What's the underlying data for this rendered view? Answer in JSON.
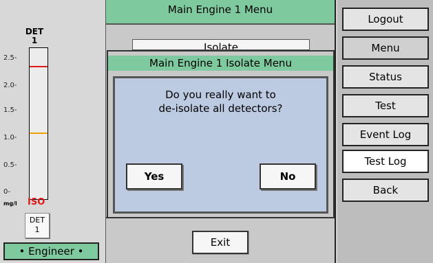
{
  "left": {
    "det_title": "DET",
    "det_number": "1",
    "ticks": [
      "2.5-",
      "2.0-",
      "1.5-",
      "1.0-",
      "0.5-",
      "0-"
    ],
    "unit": "mg/l",
    "iso_status": "ISO",
    "det_button_label": "DET",
    "det_button_number": "1",
    "user_role": "• Engineer •",
    "high_alarm_level": 2.2,
    "low_alarm_level": 1.1,
    "scale_max": 2.5,
    "colors": {
      "high": "#e01818",
      "low": "#f0a000",
      "iso": "#e01818"
    }
  },
  "main": {
    "title": "Main Engine 1 Menu",
    "isolate_peek": "Isolate",
    "exit_label": "Exit"
  },
  "dialog": {
    "title": "Main Engine 1 Isolate Menu",
    "question_line1": "Do you really want to",
    "question_line2": "de-isolate all detectors?",
    "yes_label": "Yes",
    "no_label": "No"
  },
  "nav": {
    "items": [
      {
        "label": "Logout"
      },
      {
        "label": "Menu"
      },
      {
        "label": "Status"
      },
      {
        "label": "Test"
      },
      {
        "label": "Event Log"
      },
      {
        "label": "Test Log"
      },
      {
        "label": "Back"
      }
    ]
  }
}
